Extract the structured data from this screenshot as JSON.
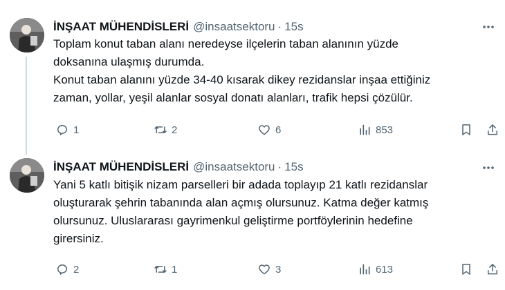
{
  "tweets": [
    {
      "author_name": "İNŞAAT MÜHENDİSLERİ",
      "handle": "@insaatsektoru",
      "separator": "·",
      "time": "15s",
      "lines": [
        "Toplam konut taban alanı neredeyse ilçelerin taban alanının yüzde",
        "doksanına ulaşmış durumda.",
        "Konut taban alanını yüzde 34-40 kısarak dikey rezidanslar inşaa ettiğiniz",
        "zaman, yollar, yeşil alanlar sosyal donatı alanları, trafik hepsi çözülür."
      ],
      "replies": "1",
      "reposts": "2",
      "likes": "6",
      "views": "853"
    },
    {
      "author_name": "İNŞAAT MÜHENDİSLERİ",
      "handle": "@insaatsektoru",
      "separator": "·",
      "time": "15s",
      "lines": [
        "Yani 5 katlı bitişik nizam parselleri bir adada toplayıp 21 katlı rezidanslar",
        "oluşturarak şehrin tabanında alan açmış olursunuz. Katma değer katmış",
        "olursunuz. Uluslararası gayrimenkul geliştirme portföylerinin hedefine",
        "girersiniz."
      ],
      "replies": "2",
      "reposts": "1",
      "likes": "3",
      "views": "613"
    }
  ],
  "icons": {
    "more": "more-horizontal-icon",
    "reply": "reply-bubble-icon",
    "repost": "repost-arrows-icon",
    "like": "heart-icon",
    "views": "views-bar-chart-icon",
    "bookmark": "bookmark-icon",
    "share": "share-upload-icon"
  },
  "colors": {
    "text": "#0f1419",
    "secondary": "#536471",
    "thread_line": "#cfd9de"
  }
}
